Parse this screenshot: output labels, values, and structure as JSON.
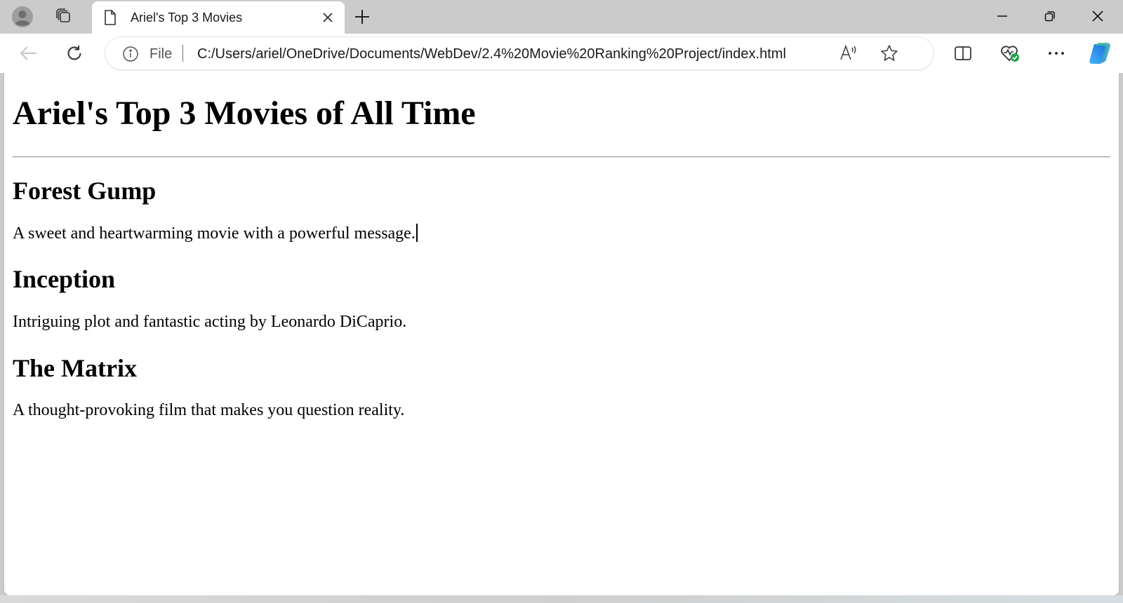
{
  "browser": {
    "tab": {
      "title": "Ariel's Top 3 Movies"
    },
    "address_bar": {
      "scheme_label": "File",
      "url": "C:/Users/ariel/OneDrive/Documents/WebDev/2.4%20Movie%20Ranking%20Project/index.html"
    },
    "icons": [
      "profile-icon",
      "workspaces-icon",
      "page-icon",
      "close-icon",
      "new-tab-icon",
      "minimize-icon",
      "restore-icon",
      "window-close-icon",
      "back-icon",
      "refresh-icon",
      "info-icon",
      "read-aloud-icon",
      "favorite-star-icon",
      "split-screen-icon",
      "browser-essentials-icon",
      "more-icon",
      "copilot-icon"
    ]
  },
  "page": {
    "title": "Ariel's Top 3 Movies of All Time",
    "movies": [
      {
        "name": "Forest Gump",
        "description": "A sweet and heartwarming movie with a powerful message."
      },
      {
        "name": "Inception",
        "description": "Intriguing plot and fantastic acting by Leonardo DiCaprio."
      },
      {
        "name": "The Matrix",
        "description": "A thought-provoking film that makes you question reality."
      }
    ]
  },
  "colors": {
    "tabstrip_bg": "#cbcbcb",
    "toolbar_bg": "#ffffff",
    "essentials_badge": "#1aa34a",
    "copilot_blue": "#2e8cf0",
    "copilot_green": "#3ec47a"
  }
}
